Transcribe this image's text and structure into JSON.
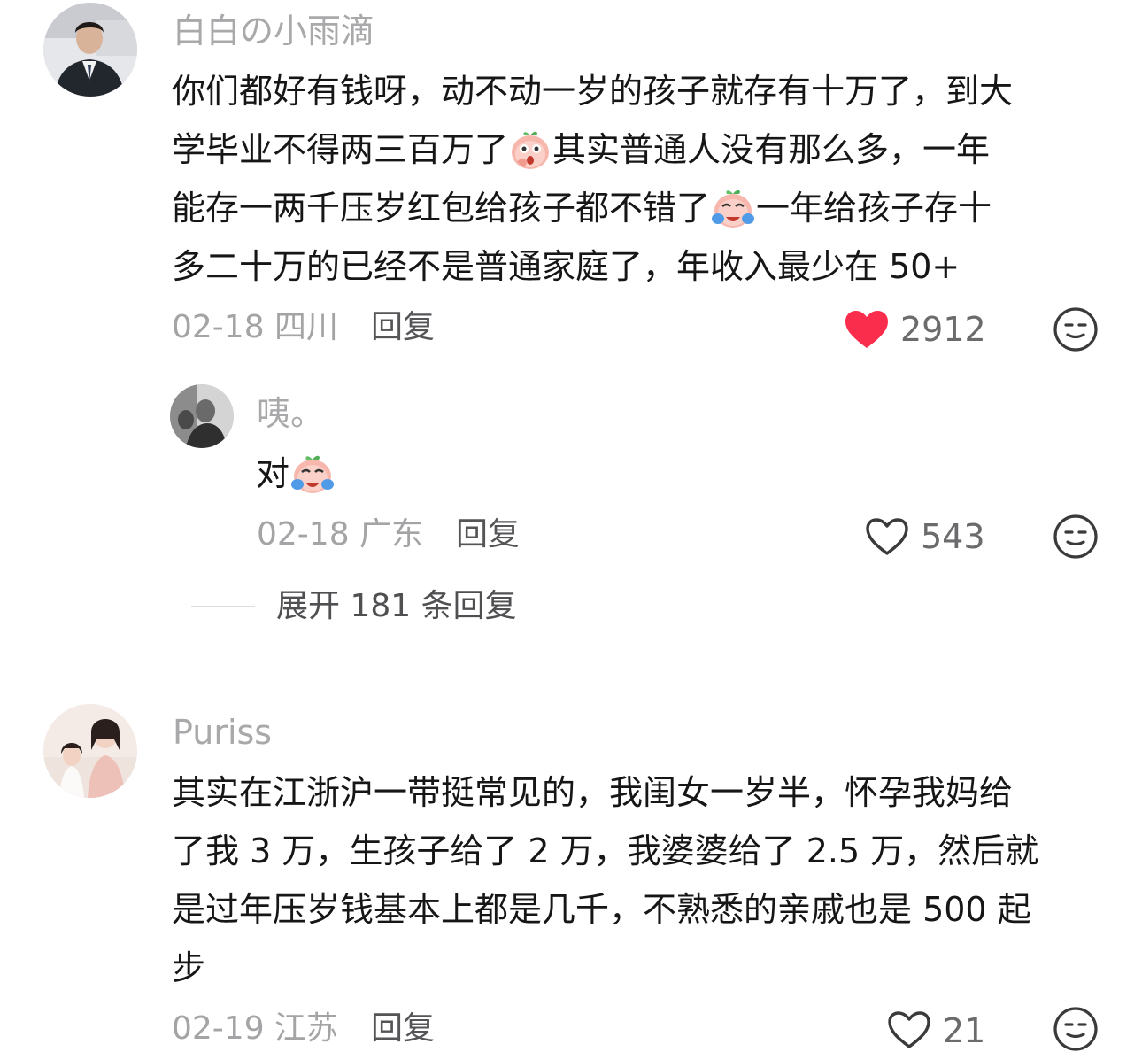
{
  "colors": {
    "liked_heart": "#fb2d4c",
    "text": "#161616",
    "muted": "#a4a4a6",
    "action": "#555558"
  },
  "comments": [
    {
      "username": "白白の小雨滴",
      "lines": [
        "你们都好有钱呀，动不动一岁的孩子就存有十万了，到大",
        [
          "学毕业不得两三百万了",
          "其实普通人没有那么多，一年"
        ],
        [
          "能存一两千压岁红包给孩子都不错了",
          "一年给孩子存十"
        ],
        "多二十万的已经不是普通家庭了，年收入最少在 50+"
      ],
      "emoji": [
        "shocked-peach-emoji",
        "crying-peach-emoji"
      ],
      "meta": "02-18 四川",
      "reply_label": "回复",
      "likes": "2912",
      "liked": true
    },
    {
      "username": "咦。",
      "text": "对",
      "emoji": [
        "crying-peach-emoji"
      ],
      "meta": "02-18 广东",
      "reply_label": "回复",
      "likes": "543",
      "liked": false
    },
    {
      "username": "Puriss",
      "lines": [
        "其实在江浙沪一带挺常见的，我闺女一岁半，怀孕我妈给",
        "了我 3 万，生孩子给了 2 万，我婆婆给了 2.5 万，然后就",
        "是过年压岁钱基本上都是几千，不熟悉的亲戚也是 500 起",
        "步"
      ],
      "meta": "02-19 江苏",
      "reply_label": "回复",
      "likes": "21",
      "liked": false
    }
  ],
  "expand_replies": "展开 181 条回复",
  "icons": {
    "like": "heart-icon",
    "dislike": "dislike-face-icon"
  }
}
